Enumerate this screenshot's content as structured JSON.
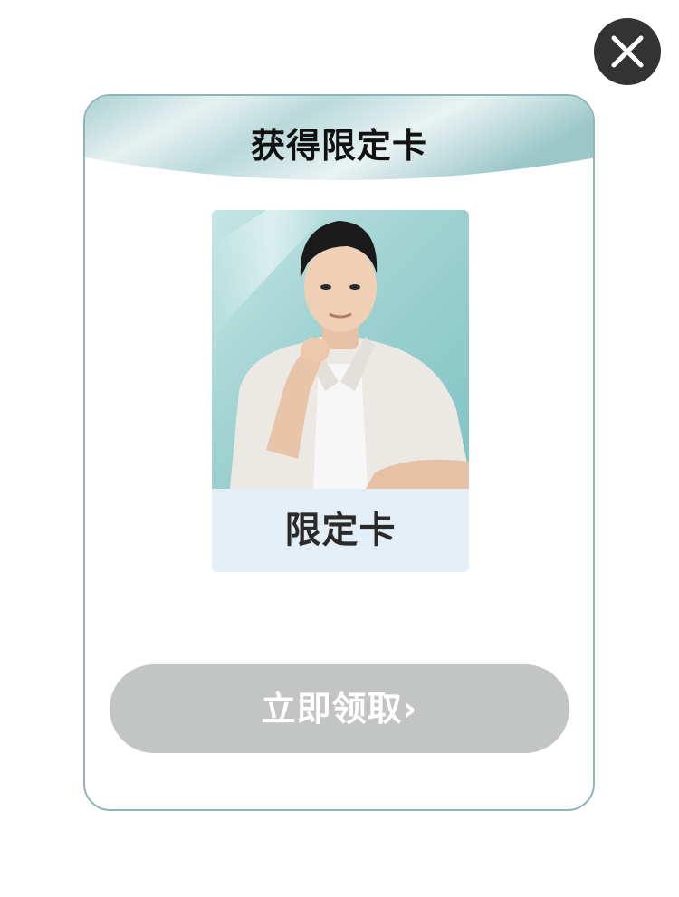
{
  "close_button": {
    "icon": "close-icon"
  },
  "modal": {
    "title": "获得限定卡",
    "card": {
      "label": "限定卡"
    },
    "claim_button": {
      "label": "立即领取",
      "chevron": "›"
    }
  },
  "colors": {
    "header_teal": "#a7cfd0",
    "card_label_bg": "#e3eef6",
    "button_disabled": "#c2c5c4",
    "modal_border": "#8fb5b8",
    "close_bg": "#333333"
  }
}
